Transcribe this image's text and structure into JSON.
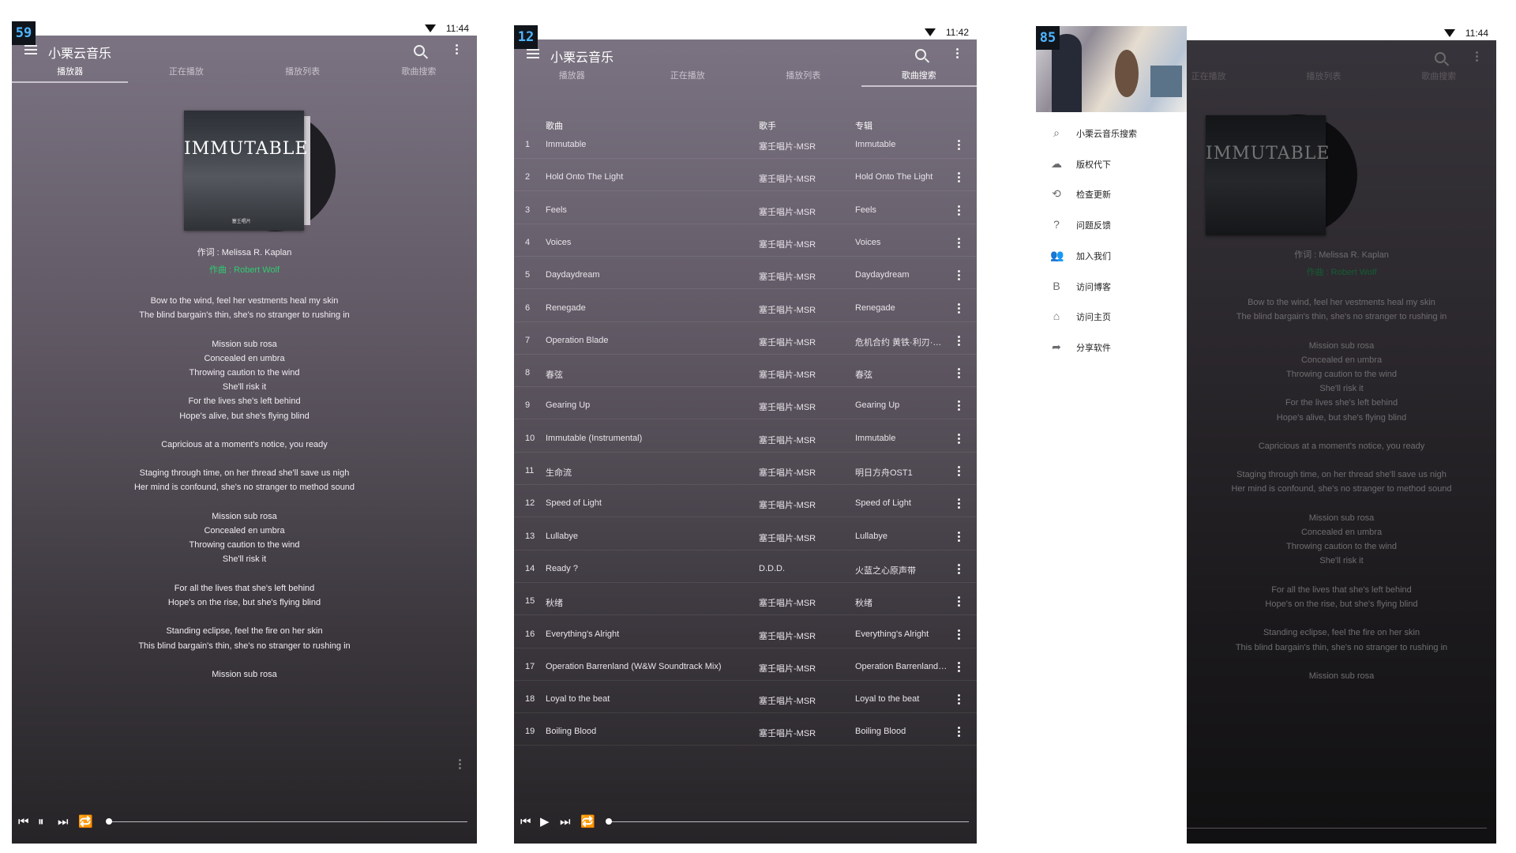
{
  "status": {
    "time1": "11:44",
    "time2": "11:42",
    "time3": "11:44"
  },
  "badges": {
    "p1": "59",
    "p2": "12",
    "p3": "85"
  },
  "app": {
    "title": "小栗云音乐"
  },
  "tabs": [
    "播放器",
    "正在播放",
    "播放列表",
    "歌曲搜索"
  ],
  "album": {
    "title": "IMMUTABLE",
    "label": "塞壬唱片"
  },
  "credits": {
    "lyricist": "作词 : Melissa R. Kaplan",
    "composer": "作曲 : Robert Wolf"
  },
  "lyrics": [
    "Bow to the wind, feel her vestments heal my skin",
    "The blind bargain's thin, she's no stranger to rushing in",
    "",
    "Mission sub rosa",
    "Concealed en umbra",
    "Throwing caution to the wind",
    "She'll risk it",
    "For the lives she's left behind",
    "Hope's alive, but she's flying blind",
    "",
    "Capricious at a moment's notice, you ready",
    "",
    "Staging through time, on her thread she'll save us nigh",
    "Her mind is confound, she's no stranger to method sound",
    "",
    "Mission sub rosa",
    "Concealed en umbra",
    "Throwing caution to the wind",
    "She'll risk it",
    "",
    "For all the lives that she's left behind",
    "Hope's on the rise, but she's flying blind",
    "",
    "Standing eclipse, feel the fire on her skin",
    "This blind bargain's thin, she's no stranger to rushing in",
    "",
    "Mission sub rosa"
  ],
  "table": {
    "headers": {
      "song": "歌曲",
      "artist": "歌手",
      "album": "专辑"
    },
    "rows": [
      {
        "n": "1",
        "song": "Immutable",
        "artist": "塞壬唱片-MSR",
        "album": "Immutable"
      },
      {
        "n": "2",
        "song": "Hold Onto The Light",
        "artist": "塞壬唱片-MSR",
        "album": "Hold Onto The Light"
      },
      {
        "n": "3",
        "song": "Feels",
        "artist": "塞壬唱片-MSR",
        "album": "Feels"
      },
      {
        "n": "4",
        "song": "Voices",
        "artist": "塞壬唱片-MSR",
        "album": "Voices"
      },
      {
        "n": "5",
        "song": "Daydaydream",
        "artist": "塞壬唱片-MSR",
        "album": "Daydaydream"
      },
      {
        "n": "6",
        "song": "Renegade",
        "artist": "塞壬唱片-MSR",
        "album": "Renegade"
      },
      {
        "n": "7",
        "song": "Operation Blade",
        "artist": "塞壬唱片-MSR",
        "album": "危机合约 黄铁·利刃·燃..."
      },
      {
        "n": "8",
        "song": "春弦",
        "artist": "塞壬唱片-MSR",
        "album": "春弦"
      },
      {
        "n": "9",
        "song": "Gearing Up",
        "artist": "塞壬唱片-MSR",
        "album": "Gearing Up"
      },
      {
        "n": "10",
        "song": "Immutable (Instrumental)",
        "artist": "塞壬唱片-MSR",
        "album": "Immutable"
      },
      {
        "n": "11",
        "song": "生命流",
        "artist": "塞壬唱片-MSR",
        "album": "明日方舟OST1"
      },
      {
        "n": "12",
        "song": "Speed of Light",
        "artist": "塞壬唱片-MSR",
        "album": "Speed of Light"
      },
      {
        "n": "13",
        "song": "Lullabye",
        "artist": "塞壬唱片-MSR",
        "album": "Lullabye"
      },
      {
        "n": "14",
        "song": "Ready ?",
        "artist": "D.D.D.",
        "album": "火蓝之心原声带"
      },
      {
        "n": "15",
        "song": "秋绪",
        "artist": "塞壬唱片-MSR",
        "album": "秋绪"
      },
      {
        "n": "16",
        "song": "Everything's Alright",
        "artist": "塞壬唱片-MSR",
        "album": "Everything's Alright"
      },
      {
        "n": "17",
        "song": "Operation Barrenland (W&W Soundtrack Mix)",
        "artist": "塞壬唱片-MSR",
        "album": "Operation Barrenland (..."
      },
      {
        "n": "18",
        "song": "Loyal to the beat",
        "artist": "塞壬唱片-MSR",
        "album": "Loyal to the beat"
      },
      {
        "n": "19",
        "song": "Boiling Blood",
        "artist": "塞壬唱片-MSR",
        "album": "Boiling Blood"
      }
    ]
  },
  "drawer": {
    "items": [
      {
        "icon": "search-icon",
        "label": "小栗云音乐搜索"
      },
      {
        "icon": "cloud-download-icon",
        "label": "版权代下"
      },
      {
        "icon": "repeat-icon",
        "label": "检查更新"
      },
      {
        "icon": "help-icon",
        "label": "问题反馈"
      },
      {
        "icon": "add-group-icon",
        "label": "加入我们"
      },
      {
        "icon": "blog-icon",
        "label": "访问博客"
      },
      {
        "icon": "home-icon",
        "label": "访问主页"
      },
      {
        "icon": "share-icon",
        "label": "分享软件"
      }
    ]
  },
  "colors": {
    "accent": "#2ecc71",
    "bg_top": "#7c7483",
    "bg_bottom": "#262427"
  }
}
